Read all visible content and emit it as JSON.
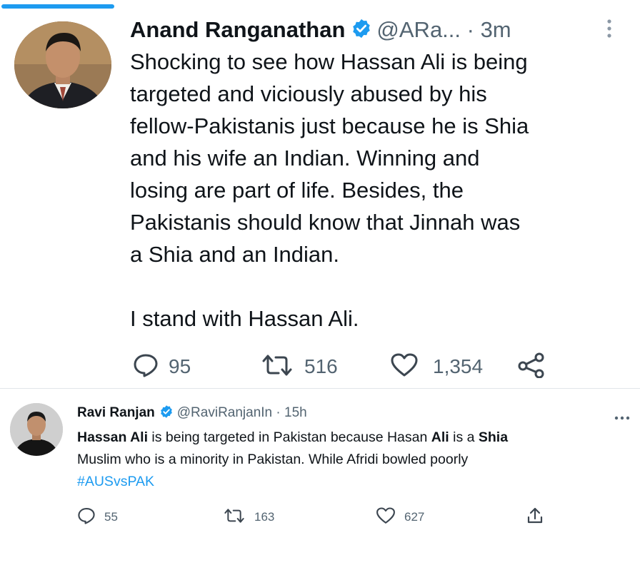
{
  "tweet1": {
    "author_name": "Anand Ranganathan",
    "handle_time": "@ARa... · 3m",
    "text": "Shocking to see how Hassan Ali is being\ntargeted and viciously abused by his\nfellow-Pakistanis just because he is Shia\nand his wife an Indian. Winning and\nlosing are part of life. Besides, the\nPakistanis should know that Jinnah was\na Shia and an Indian.\n\nI stand with Hassan Ali.",
    "replies": "95",
    "retweets": "516",
    "likes": "1,354"
  },
  "tweet2": {
    "author_name": "Ravi Ranjan",
    "handle_time": "@RaviRanjanIn · 15h",
    "text_parts": {
      "p1": "Hassan Ali",
      "p2": " is being targeted in Pakistan because Hasan ",
      "p3": "Ali",
      "p4": " is a ",
      "p5": "Shia",
      "p6": "Muslim who is a minority in Pakistan. While Afridi bowled poorly",
      "hashtag": "#AUSvsPAK"
    },
    "replies": "55",
    "retweets": "163",
    "likes": "627"
  },
  "colors": {
    "accent": "#1d9bf0",
    "text": "#0f1419",
    "secondary": "#536471"
  },
  "icons": [
    "verified-badge-icon",
    "more-vertical-icon",
    "more-horizontal-icon",
    "reply-icon",
    "retweet-icon",
    "like-icon",
    "share-icon"
  ]
}
